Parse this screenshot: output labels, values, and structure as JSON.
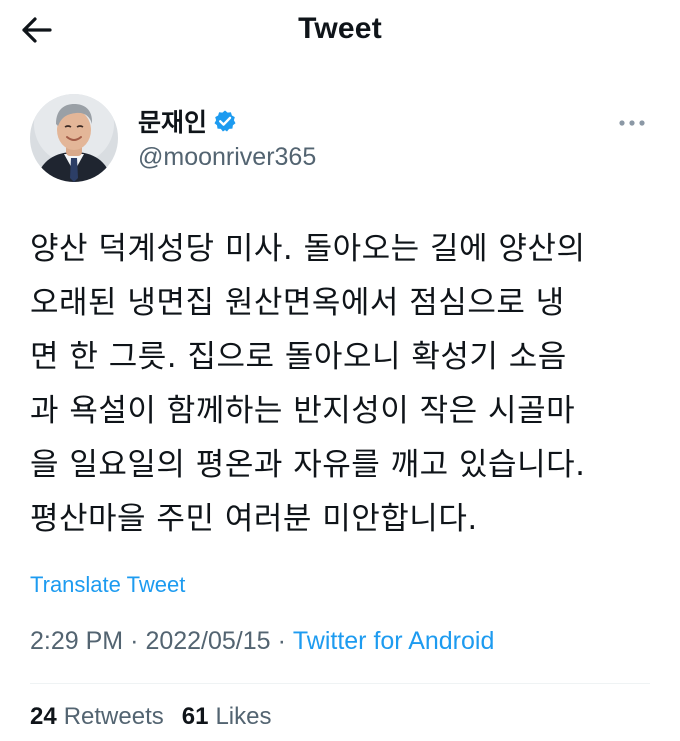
{
  "header": {
    "title": "Tweet",
    "back_icon": "arrow-left-icon"
  },
  "author": {
    "display_name": "문재인",
    "handle": "@moonriver365",
    "verified_icon": "verified-badge-icon",
    "verified_color": "#1d9bf0"
  },
  "more_icon": "more-horizontal-icon",
  "tweet": {
    "text": "양산 덕계성당 미사. 돌아오는 길에 양산의\n오래된 냉면집 원산면옥에서 점심으로 냉\n면 한 그릇. 집으로 돌아오니 확성기 소음\n과 욕설이 함께하는 반지성이 작은 시골마\n을 일요일의 평온과 자유를 깨고 있습니다.\n평산마을 주민 여러분 미안합니다.",
    "translate_label": "Translate Tweet"
  },
  "meta": {
    "time": "2:29 PM",
    "separator": "·",
    "date": "2022/05/15",
    "source": "Twitter for Android"
  },
  "stats": {
    "retweets_count": "24",
    "retweets_label": "Retweets",
    "likes_count": "61",
    "likes_label": "Likes"
  },
  "colors": {
    "accent": "#1d9bf0",
    "text": "#0f1419",
    "secondary": "#536471"
  }
}
